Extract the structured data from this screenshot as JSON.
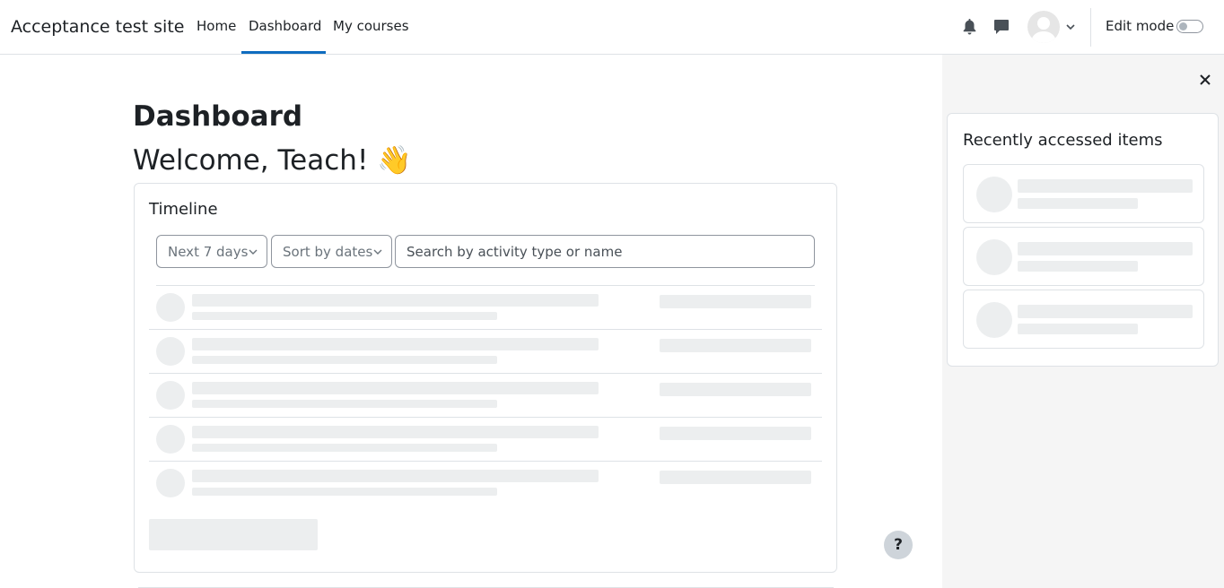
{
  "navbar": {
    "brand": "Acceptance test site",
    "links": [
      {
        "label": "Home",
        "active": false
      },
      {
        "label": "Dashboard",
        "active": true
      },
      {
        "label": "My courses",
        "active": false
      }
    ],
    "edit_mode_label": "Edit mode",
    "edit_mode_on": false,
    "icons": [
      "bell-icon",
      "chat-icon",
      "avatar",
      "chevron-down-icon"
    ]
  },
  "main": {
    "page_title": "Dashboard",
    "welcome": "Welcome, Teach! 👋",
    "timeline": {
      "title": "Timeline",
      "filter_label": "Next 7 days",
      "sort_label": "Sort by dates",
      "search_placeholder": "Search by activity type or name",
      "placeholder_rows": 5
    },
    "help_label": "?"
  },
  "drawer": {
    "title": "Recently accessed items",
    "placeholder_items": 3
  },
  "colors": {
    "accent": "#0f6cbf",
    "skeleton": "#eceeef",
    "drawer_bg": "#f5f5f5",
    "border": "#dee2e6"
  }
}
